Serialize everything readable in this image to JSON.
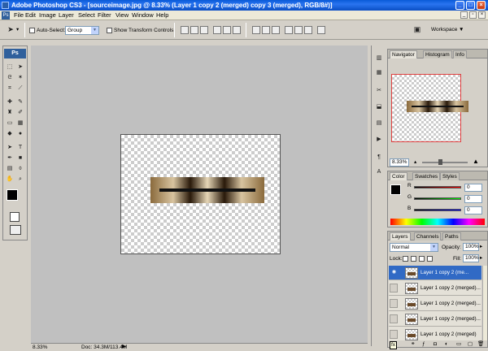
{
  "window": {
    "title": "Adobe Photoshop CS3 - [sourceimage.jpg @ 8.33% (Layer 1 copy 2 (merged) copy 3 (merged), RGB/8#)]"
  },
  "menu": {
    "ps_label": "Ps",
    "items": [
      "File",
      "Edit",
      "Image",
      "Layer",
      "Select",
      "Filter",
      "View",
      "Window",
      "Help"
    ]
  },
  "options": {
    "auto_select_label": "Auto-Select:",
    "auto_select_value": "Group",
    "show_transform_label": "Show Transform Controls",
    "workspace_label": "Workspace"
  },
  "toolbox": {
    "logo": "Ps"
  },
  "status": {
    "zoom": "8.33%",
    "doc": "Doc: 34.3M/113.4M"
  },
  "navigator": {
    "tabs": [
      "Navigator",
      "Histogram",
      "Info"
    ],
    "zoom": "8.33%"
  },
  "color": {
    "tabs": [
      "Color",
      "Swatches",
      "Styles"
    ],
    "r_label": "R",
    "g_label": "G",
    "b_label": "B",
    "r_value": "0",
    "g_value": "0",
    "b_value": "0"
  },
  "layers": {
    "tabs": [
      "Layers",
      "Channels",
      "Paths"
    ],
    "blend_mode": "Normal",
    "opacity_label": "Opacity:",
    "opacity_value": "100%",
    "lock_label": "Lock:",
    "fill_label": "Fill:",
    "fill_value": "100%",
    "items": [
      {
        "name": "Layer 1 copy 2 (me...",
        "visible": true,
        "active": true
      },
      {
        "name": "Layer 1 copy 2 (merged)...",
        "visible": false,
        "active": false
      },
      {
        "name": "Layer 1 copy 2 (merged)...",
        "visible": false,
        "active": false
      },
      {
        "name": "Layer 1 copy 2 (merged)...",
        "visible": false,
        "active": false
      },
      {
        "name": "Layer 1 copy 2 (merged)",
        "visible": false,
        "active": false
      }
    ],
    "tooltip": "fx"
  },
  "colors": {
    "accent": "#316ac5",
    "titlebar": "#0a5ad8",
    "nav_frame": "#e04040"
  }
}
